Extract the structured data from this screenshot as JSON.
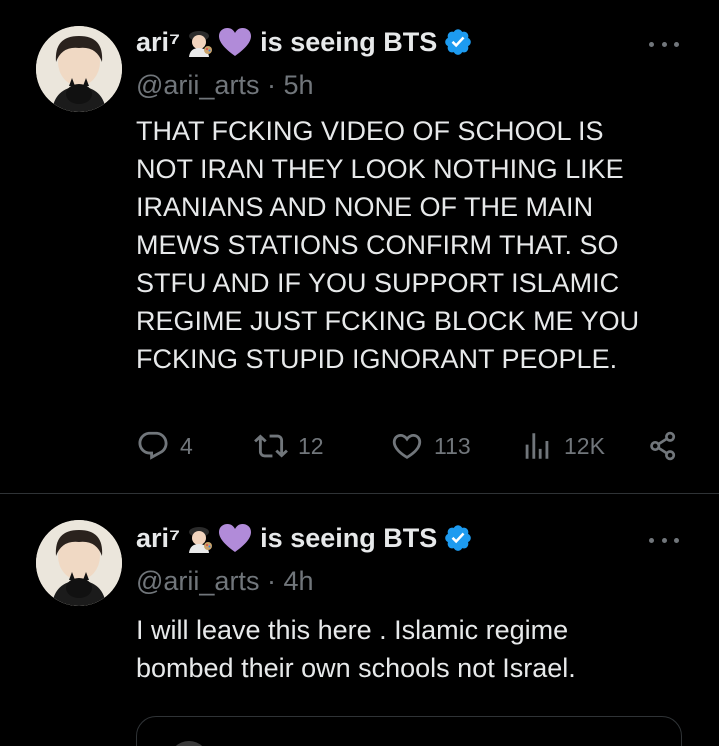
{
  "tweets": [
    {
      "display_name": "ari⁷",
      "status_text": "is seeing BTS",
      "handle": "@arii_arts",
      "time": "· 5h",
      "body_lines": [
        "THAT FCKING VIDEO OF SCHOOL IS",
        "NOT IRAN THEY LOOK NOTHING LIKE",
        "IRANIANS AND NONE OF THE MAIN",
        "MEWS STATIONS CONFIRM THAT. SO",
        "STFU AND IF YOU SUPPORT ISLAMIC",
        "REGIME JUST FCKING BLOCK ME YOU",
        "FCKING STUPID IGNORANT PEOPLE."
      ],
      "stats": {
        "replies": "4",
        "retweets": "12",
        "likes": "113",
        "views": "12K"
      }
    },
    {
      "display_name": "ari⁷",
      "status_text": "is seeing BTS",
      "handle": "@arii_arts",
      "time": "· 4h",
      "body_lines": [
        "I will leave this here . Islamic regime",
        "bombed their own schools not Israel."
      ]
    }
  ],
  "icons": {
    "reply": "reply-icon",
    "retweet": "retweet-icon",
    "like": "heart-icon",
    "views": "analytics-icon",
    "share": "share-icon",
    "more": "more-icon",
    "verified": "verified-badge-icon",
    "artist_emoji": "artist-emoji-icon",
    "heart_emoji": "purple-heart-emoji-icon"
  },
  "colors": {
    "background": "#000000",
    "text": "#e7e9ea",
    "secondary": "#71767b",
    "verified": "#1d9bf0",
    "purple_heart": "#b18bd9",
    "divider": "#2f3336"
  }
}
